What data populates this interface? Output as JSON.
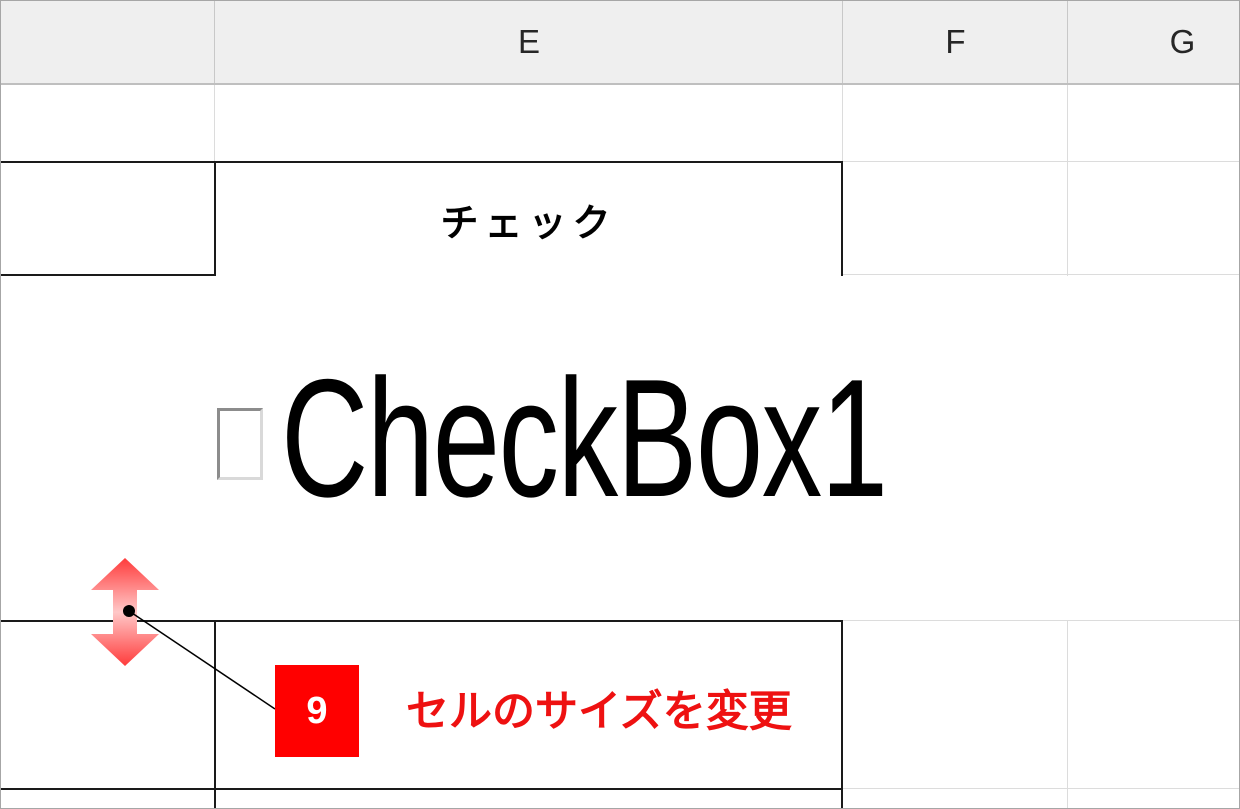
{
  "columns": {
    "e": "E",
    "f": "F",
    "g": "G"
  },
  "header_cell": {
    "text": "チェック"
  },
  "checkbox": {
    "label": "CheckBox1",
    "checked": false
  },
  "annotation": {
    "step_number": "9",
    "text": "セルのサイズを変更"
  },
  "icons": {
    "resize": "row-resize-double-arrow-icon"
  },
  "colors": {
    "accent_red": "#ff0000",
    "annotation_text": "#ee1111",
    "header_bg": "#efefef",
    "grid": "#dcdcdc"
  }
}
